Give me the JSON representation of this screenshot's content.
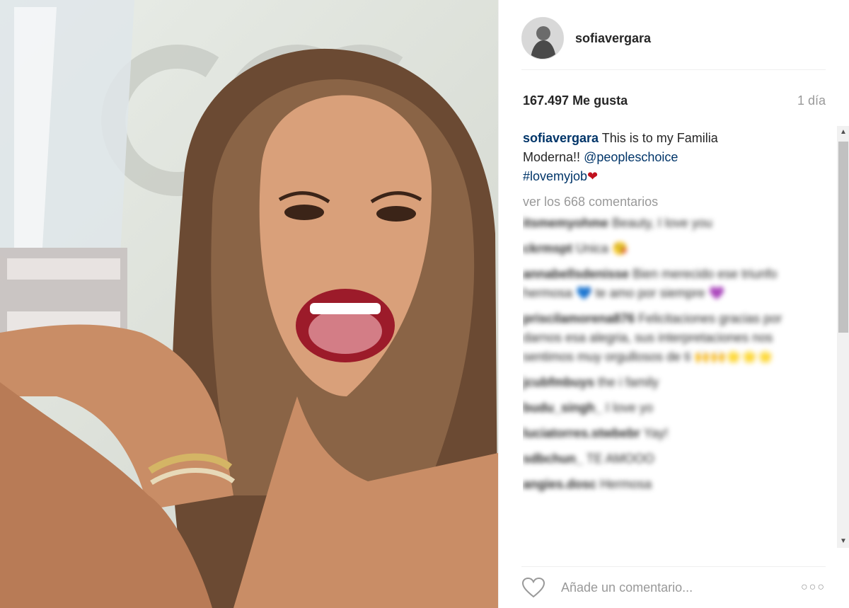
{
  "post": {
    "username": "sofiavergara",
    "likes": "167.497 Me gusta",
    "time": "1 día",
    "caption": {
      "user": "sofiavergara",
      "text": "This is to my Familia Moderna!!",
      "mention": "@peopleschoice",
      "hashtag": "#lovemyjob",
      "emoji": "❤"
    },
    "view_all": "ver los 668 comentarios",
    "comments": [
      {
        "user": "itsmemyohme",
        "text": "Beauty, I love you"
      },
      {
        "user": "ckrmspt",
        "text": "Unica 😘"
      },
      {
        "user": "annabellsdenisse",
        "text": "Bien merecido ese triunfo hermosa 💙 te amo por siempre 💜"
      },
      {
        "user": "priscilamorena876",
        "text": "Felicitaciones gracias por darnos esa alegria, sus interpretaciones nos sentimos muy orgullosos de ti 🙌🙌🌟🌟🌟"
      },
      {
        "user": "jcubfmbuys",
        "text": "the i family"
      },
      {
        "user": "budu_singh_",
        "text": "I love yo"
      },
      {
        "user": "luciatorres.stwbebr",
        "text": "Yay!"
      },
      {
        "user": "sdbchun_",
        "text": "TE AMOOO"
      },
      {
        "user": "angies.dosc",
        "text": "Hermosa"
      }
    ],
    "add_comment_placeholder": "Añade un comentario...",
    "more_label": "○○○"
  },
  "icons": {
    "like": "heart-outline-icon",
    "more": "more-options-icon"
  },
  "colors": {
    "link": "#003569",
    "muted": "#999999",
    "heart": "#c1121f"
  }
}
